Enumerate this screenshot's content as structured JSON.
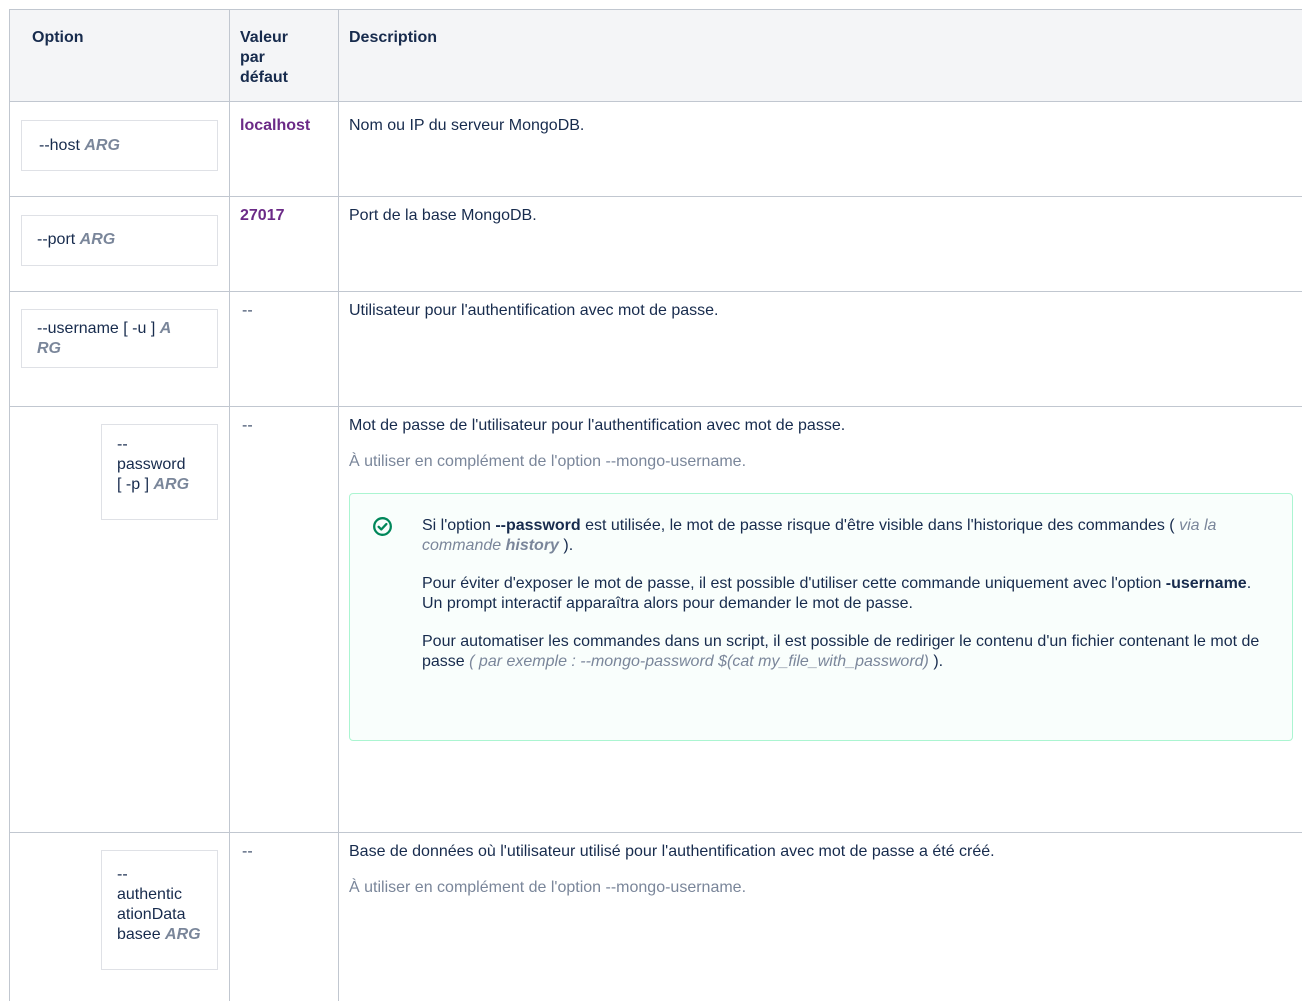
{
  "headers": {
    "option": "Option",
    "default_l1": "Valeur",
    "default_l2": "par",
    "default_l3": "défaut",
    "description": "Description"
  },
  "rows": [
    {
      "option": "--host ",
      "arg": "ARG",
      "default": "localhost",
      "description": "Nom ou IP du serveur MongoDB."
    },
    {
      "option": "--port ",
      "arg": "ARG",
      "default": "27017",
      "description": "Port de la base MongoDB."
    },
    {
      "option_l1": "--username [ -u ] ",
      "arg_l1": "A",
      "arg_l2": "RG",
      "default": "--",
      "description": "Utilisateur pour l'authentification avec mot de passe."
    },
    {
      "option_l1": "--",
      "option_l2": "password",
      "option_l3": "[ -p ] ",
      "arg": "ARG",
      "default": "--",
      "description": "Mot de passe de l'utilisateur pour l'authentification avec mot de passe.",
      "note": "À utiliser en complément de l'option --mongo-username.",
      "panel": {
        "icon": "check-circle-icon",
        "p1_a": "Si l'option ",
        "p1_b": "--password",
        "p1_c": " est utilisée, le mot de passe risque d'être visible dans l'historique des commandes ( ",
        "p1_d": "via la commande ",
        "p1_e": "history",
        "p1_f": " ).",
        "p2_a": "Pour éviter d'exposer le mot de passe, il est possible d'utiliser cette commande uniquement avec l'option ",
        "p2_b": "-username",
        "p2_c": ". Un prompt interactif apparaîtra alors pour demander le mot de passe.",
        "p3_a": "Pour automatiser les commandes dans un script, il est possible de rediriger le contenu d'un fichier contenant le mot de passe ",
        "p3_b": "( par exemple : --mongo-password $(cat my_file_with_password)",
        "p3_c": " )."
      }
    },
    {
      "option_l1": "--",
      "option_l2": "authentic",
      "option_l3": "ationData",
      "option_l4": "basee ",
      "arg": "ARG",
      "default": "--",
      "description": "Base de données où l'utilisateur utilisé pour l'authentification avec mot de passe a été créé.",
      "note": "À utiliser en complément de l'option --mongo-username."
    }
  ],
  "colors": {
    "border": "#c1c7d0",
    "header_bg": "#f4f5f7",
    "default_value": "#6b2a87",
    "arg": "#7a869a",
    "success_border": "#abf5d1",
    "success_icon": "#00875a"
  }
}
